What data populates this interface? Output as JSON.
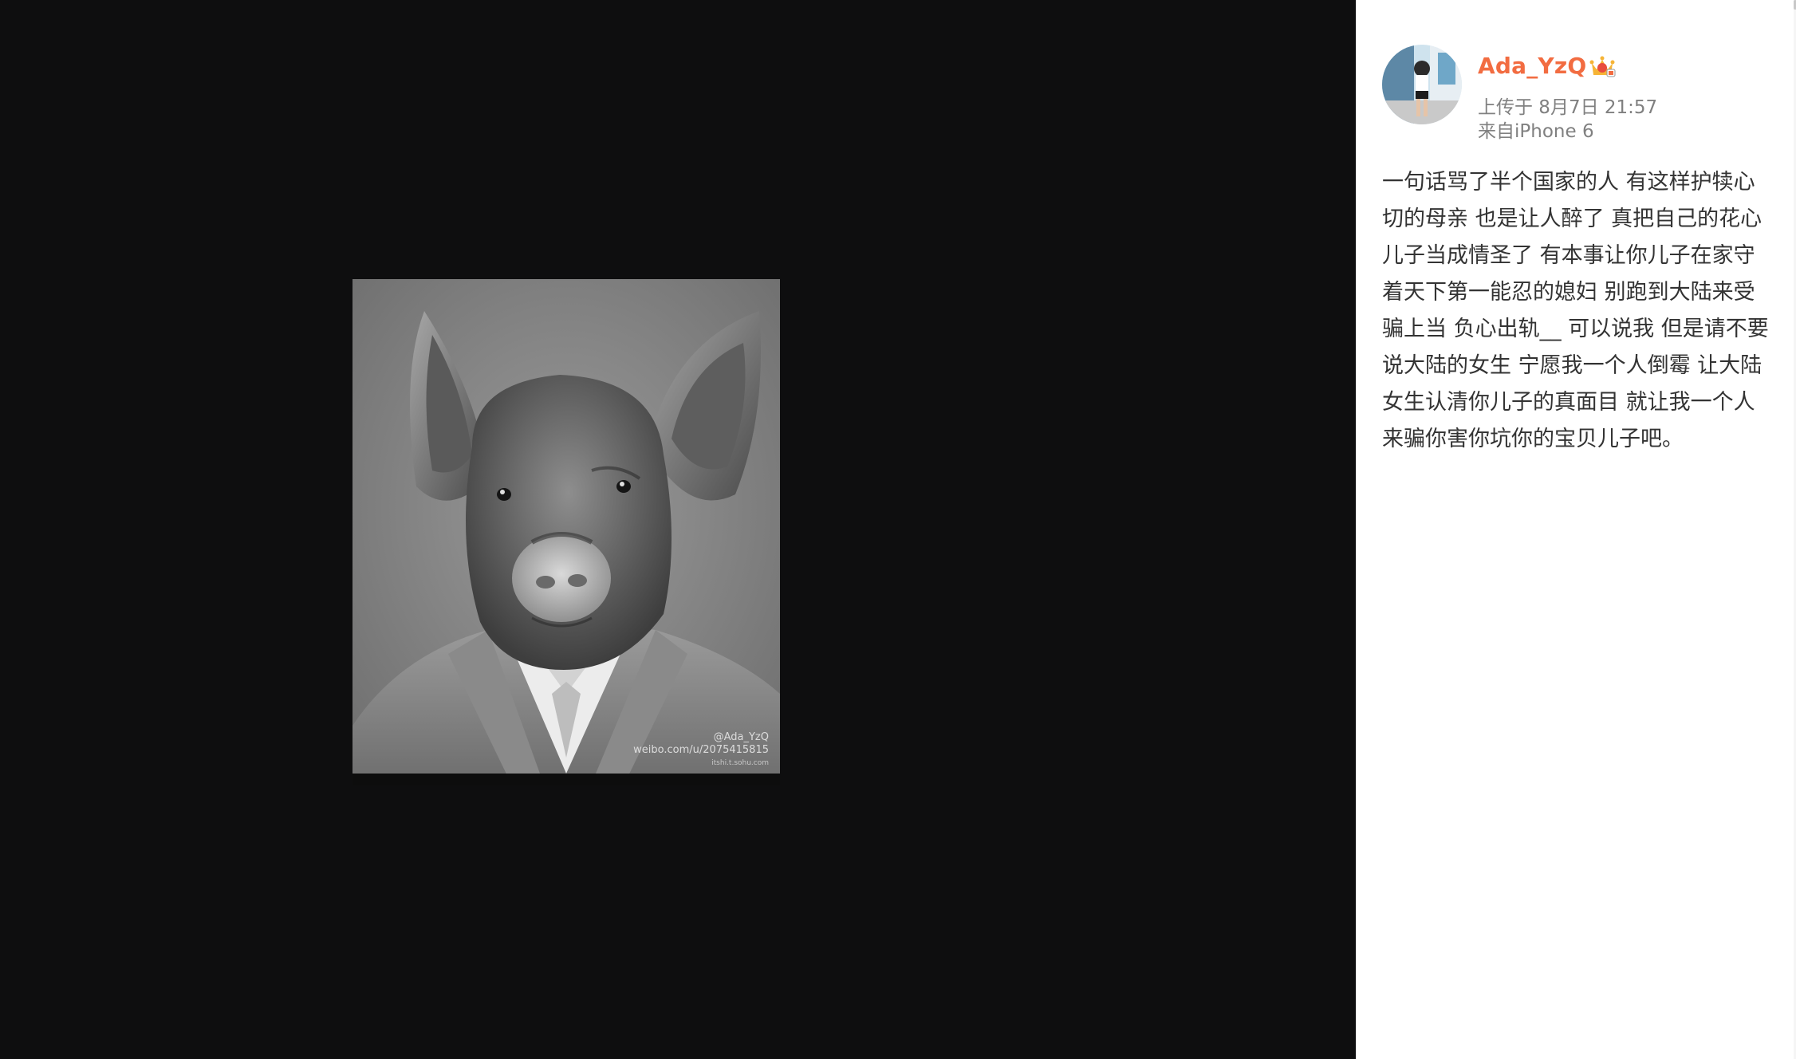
{
  "viewer": {
    "watermark_line1": "@Ada_YzQ",
    "watermark_line2": "weibo.com/u/2075415815",
    "watermark_line3": "itshi.t.sohu.com"
  },
  "post": {
    "username": "Ada_YzQ",
    "upload_time": "上传于 8月7日 21:57",
    "source": "来自iPhone 6",
    "text": "一句话骂了半个国家的人 有这样护犊心\n切的母亲 也是让人醉了 真把自己的花心\n儿子当成情圣了 有本事让你儿子在家守\n着天下第一能忍的媳妇 别跑到大陆来受\n骗上当 负心出轨__ 可以说我 但是请不要\n说大陆的女生 宁愿我一个人倒霉 让大陆\n女生认清你儿子的真面目 就让我一个人\n来骗你害你坑你的宝贝儿子吧。"
  },
  "colors": {
    "viewer_bg": "#0e0e0f",
    "username": "#f26c41",
    "meta": "#808080",
    "text": "#333333"
  }
}
